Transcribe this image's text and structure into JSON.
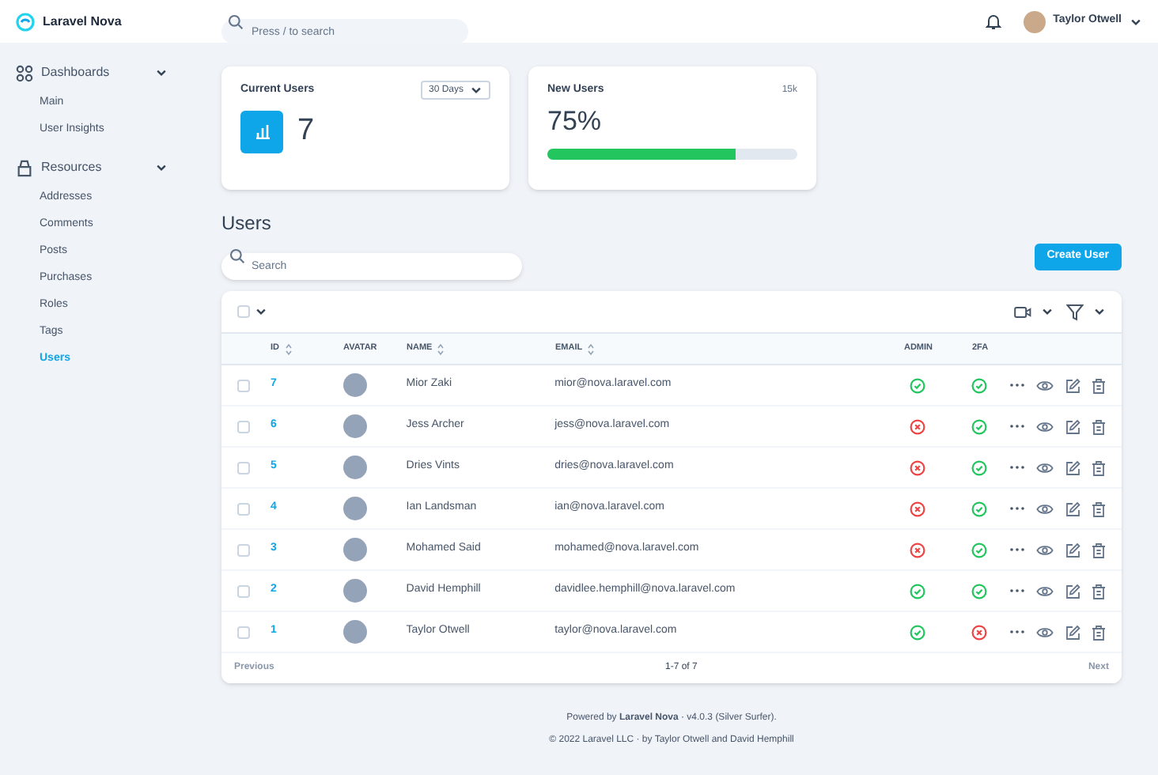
{
  "header": {
    "brand": "Laravel Nova",
    "search_placeholder": "Press / to search",
    "user_name": "Taylor Otwell"
  },
  "sidebar": [
    {
      "label": "Dashboards",
      "expanded": true,
      "items": [
        {
          "label": "Main",
          "selected": false
        },
        {
          "label": "User Insights",
          "selected": false
        }
      ]
    },
    {
      "label": "Resources",
      "expanded": true,
      "items": [
        {
          "label": "Addresses",
          "selected": false
        },
        {
          "label": "Comments",
          "selected": false
        },
        {
          "label": "Posts",
          "selected": false
        },
        {
          "label": "Purchases",
          "selected": false
        },
        {
          "label": "Roles",
          "selected": false
        },
        {
          "label": "Tags",
          "selected": false
        },
        {
          "label": "Users",
          "selected": true
        }
      ]
    }
  ],
  "metrics": [
    {
      "kind": "value",
      "title": "Current Users",
      "range": "30 Days",
      "value": "7"
    },
    {
      "kind": "progress",
      "title": "New Users",
      "target": "15k",
      "value": "75%",
      "level": 0.75
    }
  ],
  "resource": {
    "title": "Users",
    "search_placeholder": "Search",
    "create_button": "Create User"
  },
  "table": {
    "select_all_checked": false,
    "columns": [
      "ID",
      "AVATAR",
      "NAME",
      "EMAIL",
      "ADMIN",
      "2FA"
    ],
    "rows": [
      {
        "id": "7",
        "name": "Mior Zaki",
        "email": "mior@nova.laravel.com",
        "admin": true,
        "two_fa": true,
        "checked": false
      },
      {
        "id": "6",
        "name": "Jess Archer",
        "email": "jess@nova.laravel.com",
        "admin": false,
        "two_fa": true,
        "checked": false
      },
      {
        "id": "5",
        "name": "Dries Vints",
        "email": "dries@nova.laravel.com",
        "admin": false,
        "two_fa": true,
        "checked": false
      },
      {
        "id": "4",
        "name": "Ian Landsman",
        "email": "ian@nova.laravel.com",
        "admin": false,
        "two_fa": true,
        "checked": false
      },
      {
        "id": "3",
        "name": "Mohamed Said",
        "email": "mohamed@nova.laravel.com",
        "admin": false,
        "two_fa": true,
        "checked": false
      },
      {
        "id": "2",
        "name": "David Hemphill",
        "email": "davidlee.hemphill@nova.laravel.com",
        "admin": true,
        "two_fa": true,
        "checked": false
      },
      {
        "id": "1",
        "name": "Taylor Otwell",
        "email": "taylor@nova.laravel.com",
        "admin": true,
        "two_fa": false,
        "checked": false
      }
    ],
    "pagination": {
      "previous": "Previous",
      "summary": "1-7 of 7",
      "next": "Next"
    }
  },
  "footer": {
    "powered": "Powered by **Laravel Nova** · v4.0.3 (Silver Surfer).",
    "copyright": "© 2022 Laravel LLC · by Taylor Otwell and David Hemphill"
  }
}
